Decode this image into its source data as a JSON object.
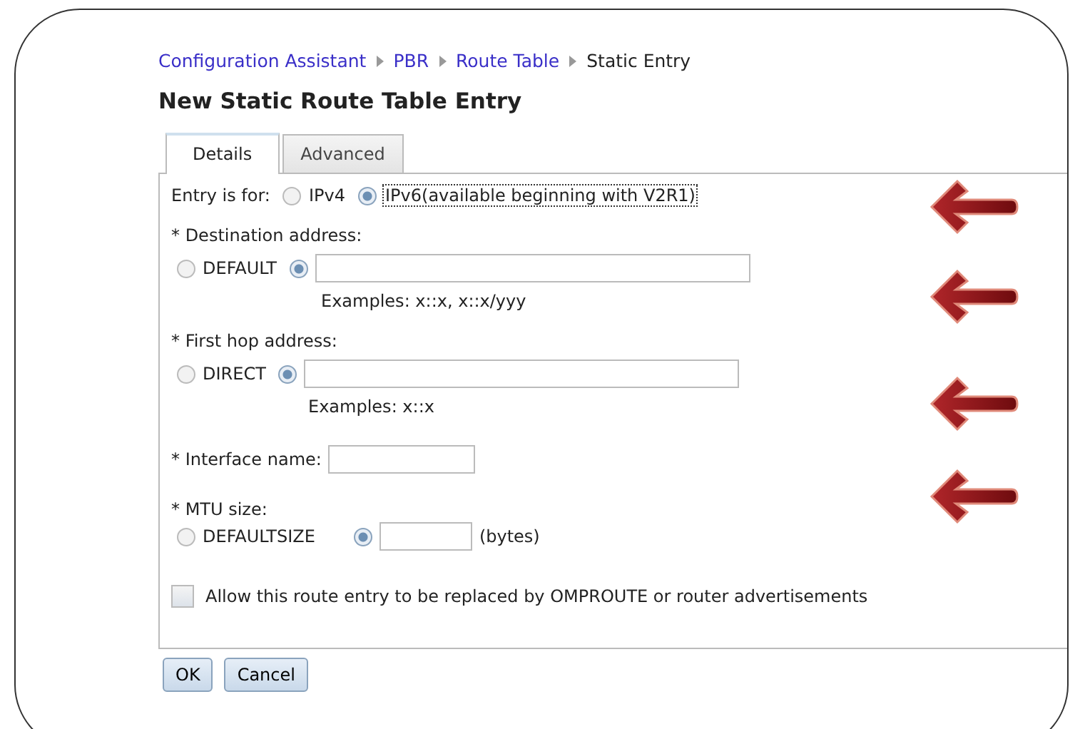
{
  "breadcrumb": [
    {
      "label": "Configuration Assistant",
      "link": true
    },
    {
      "label": "PBR",
      "link": true
    },
    {
      "label": "Route Table",
      "link": true
    },
    {
      "label": "Static Entry",
      "link": false
    }
  ],
  "title": "New Static Route Table Entry",
  "tabs": [
    {
      "label": "Details",
      "selected": true
    },
    {
      "label": "Advanced",
      "selected": false
    }
  ],
  "entry_for": {
    "label": "Entry is for:",
    "options": [
      {
        "label": "IPv4",
        "selected": false
      },
      {
        "label": "IPv6(available beginning with V2R1)",
        "selected": true
      }
    ]
  },
  "destination": {
    "label": "* Destination address:",
    "default_label": "DEFAULT",
    "default_selected": false,
    "custom_selected": true,
    "example": "Examples: x::x, x::x/yyy"
  },
  "first_hop": {
    "label": "* First hop address:",
    "default_label": "DIRECT",
    "default_selected": false,
    "custom_selected": true,
    "example": "Examples: x::x"
  },
  "interface_name": {
    "label": "* Interface name:"
  },
  "mtu": {
    "label": "* MTU size:",
    "default_label": "DEFAULTSIZE",
    "default_selected": false,
    "custom_selected": true,
    "unit": "(bytes)"
  },
  "allow_replace": {
    "label": "Allow this route entry to be replaced by OMPROUTE or router advertisements",
    "checked": false
  },
  "buttons": [
    "OK",
    "Cancel"
  ]
}
